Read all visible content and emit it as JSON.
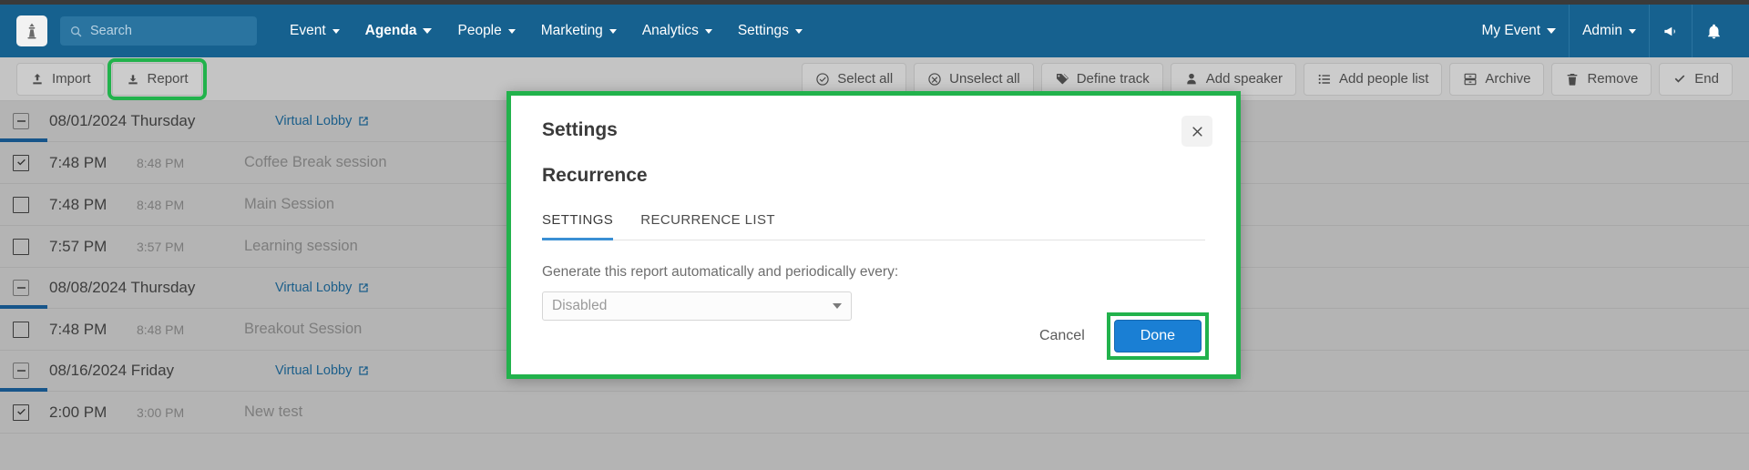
{
  "navbar": {
    "logo_icon": "podium-logo-icon",
    "search": {
      "placeholder": "Search",
      "value": "",
      "icon": "search-icon"
    },
    "items": [
      {
        "label": "Event",
        "active": false
      },
      {
        "label": "Agenda",
        "active": true
      },
      {
        "label": "People",
        "active": false
      },
      {
        "label": "Marketing",
        "active": false
      },
      {
        "label": "Analytics",
        "active": false
      },
      {
        "label": "Settings",
        "active": false
      }
    ],
    "right_items": [
      {
        "label": "My Event"
      },
      {
        "label": "Admin"
      }
    ],
    "icons": [
      {
        "name": "megaphone-icon"
      },
      {
        "name": "bell-icon"
      }
    ],
    "bg_color": "#16618f"
  },
  "toolbar": {
    "left": [
      {
        "label": "Import",
        "icon": "upload-icon",
        "highlighted": false
      },
      {
        "label": "Report",
        "icon": "download-icon",
        "highlighted": true
      }
    ],
    "right": [
      {
        "label": "Select all",
        "icon": "check-circle-icon"
      },
      {
        "label": "Unselect all",
        "icon": "x-circle-icon"
      },
      {
        "label": "Define track",
        "icon": "tag-icon"
      },
      {
        "label": "Add speaker",
        "icon": "person-icon"
      },
      {
        "label": "Add people list",
        "icon": "list-icon"
      },
      {
        "label": "Archive",
        "icon": "archive-icon"
      },
      {
        "label": "Remove",
        "icon": "trash-icon"
      },
      {
        "label": "End",
        "icon": "check-icon"
      }
    ],
    "highlight_color": "#22b24c"
  },
  "agenda": {
    "virtual_lobby_label": "Virtual Lobby",
    "rows": [
      {
        "kind": "day",
        "date": "08/01/2024 Thursday"
      },
      {
        "kind": "session",
        "start": "7:48 PM",
        "end": "8:48 PM",
        "name": "Coffee Break session",
        "checked": true
      },
      {
        "kind": "session",
        "start": "7:48 PM",
        "end": "8:48 PM",
        "name": "Main Session",
        "checked": false
      },
      {
        "kind": "session",
        "start": "7:57 PM",
        "end": "3:57 PM",
        "name": "Learning session",
        "checked": false
      },
      {
        "kind": "day",
        "date": "08/08/2024 Thursday"
      },
      {
        "kind": "session",
        "start": "7:48 PM",
        "end": "8:48 PM",
        "name": "Breakout Session",
        "checked": false
      },
      {
        "kind": "day",
        "date": "08/16/2024 Friday"
      },
      {
        "kind": "session",
        "start": "2:00 PM",
        "end": "3:00 PM",
        "name": "New test",
        "checked": true
      }
    ]
  },
  "modal": {
    "title": "Settings",
    "subtitle": "Recurrence",
    "close_icon": "close-icon",
    "tabs": [
      {
        "label": "SETTINGS",
        "active": true
      },
      {
        "label": "RECURRENCE LIST",
        "active": false
      }
    ],
    "field_label": "Generate this report automatically and periodically every:",
    "select": {
      "value": "Disabled",
      "icon": "chevron-down-icon"
    },
    "cancel_label": "Cancel",
    "done_label": "Done",
    "done_highlighted": true,
    "border_color": "#22b24c",
    "done_color": "#1a7fd4"
  }
}
